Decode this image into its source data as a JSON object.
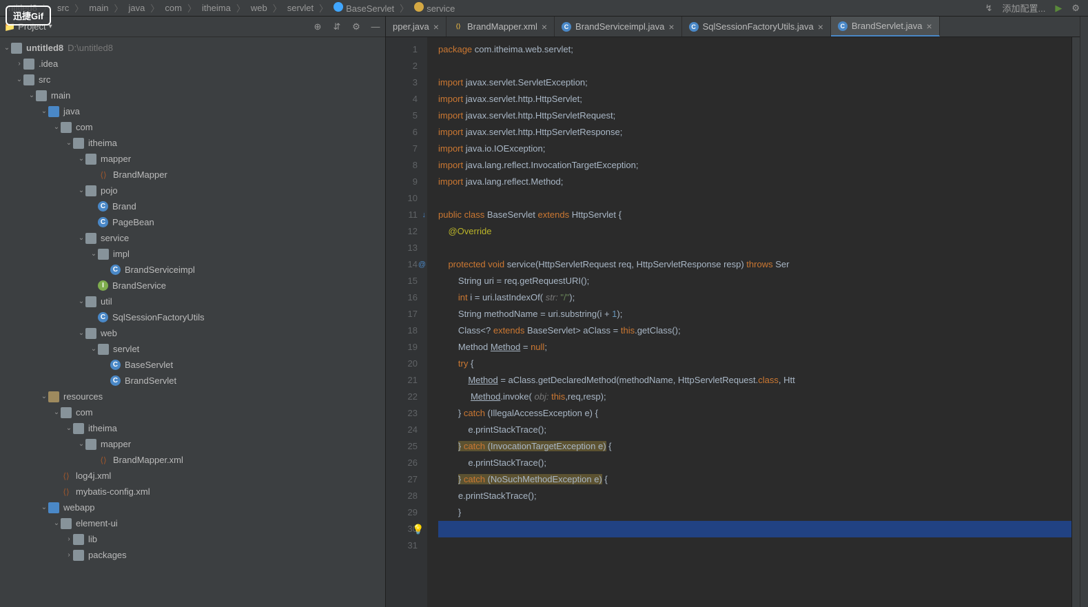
{
  "gifBadge": "迅捷Gif",
  "breadcrumb": {
    "items": [
      "ntitled8",
      "src",
      "main",
      "java",
      "com",
      "itheima",
      "web",
      "servlet",
      "BaseServlet",
      "service"
    ],
    "config": "添加配置..."
  },
  "sidebar": {
    "title": "Project",
    "root": {
      "label": "untitled8",
      "path": "D:\\untitled8"
    },
    "tree": [
      {
        "depth": 1,
        "chev": "›",
        "icon": "folder",
        "label": ".idea"
      },
      {
        "depth": 1,
        "chev": "⌄",
        "icon": "folder",
        "label": "src"
      },
      {
        "depth": 2,
        "chev": "⌄",
        "icon": "folder",
        "label": "main"
      },
      {
        "depth": 3,
        "chev": "⌄",
        "icon": "folder-blue",
        "label": "java"
      },
      {
        "depth": 4,
        "chev": "⌄",
        "icon": "folder",
        "label": "com"
      },
      {
        "depth": 5,
        "chev": "⌄",
        "icon": "folder",
        "label": "itheima"
      },
      {
        "depth": 6,
        "chev": "⌄",
        "icon": "folder",
        "label": "mapper"
      },
      {
        "depth": 7,
        "chev": "",
        "icon": "xml",
        "label": "BrandMapper"
      },
      {
        "depth": 6,
        "chev": "⌄",
        "icon": "folder",
        "label": "pojo"
      },
      {
        "depth": 7,
        "chev": "",
        "icon": "circle-c",
        "label": "Brand"
      },
      {
        "depth": 7,
        "chev": "",
        "icon": "circle-c",
        "label": "PageBean"
      },
      {
        "depth": 6,
        "chev": "⌄",
        "icon": "folder",
        "label": "service"
      },
      {
        "depth": 7,
        "chev": "⌄",
        "icon": "folder",
        "label": "impl"
      },
      {
        "depth": 8,
        "chev": "",
        "icon": "circle-c",
        "label": "BrandServiceimpl"
      },
      {
        "depth": 7,
        "chev": "",
        "icon": "circle-i",
        "label": "BrandService"
      },
      {
        "depth": 6,
        "chev": "⌄",
        "icon": "folder",
        "label": "util"
      },
      {
        "depth": 7,
        "chev": "",
        "icon": "circle-c",
        "label": "SqlSessionFactoryUtils"
      },
      {
        "depth": 6,
        "chev": "⌄",
        "icon": "folder",
        "label": "web"
      },
      {
        "depth": 7,
        "chev": "⌄",
        "icon": "folder",
        "label": "servlet"
      },
      {
        "depth": 8,
        "chev": "",
        "icon": "circle-c",
        "label": "BaseServlet"
      },
      {
        "depth": 8,
        "chev": "",
        "icon": "circle-c",
        "label": "BrandServlet"
      },
      {
        "depth": 3,
        "chev": "⌄",
        "icon": "folder-tan",
        "label": "resources"
      },
      {
        "depth": 4,
        "chev": "⌄",
        "icon": "folder",
        "label": "com"
      },
      {
        "depth": 5,
        "chev": "⌄",
        "icon": "folder",
        "label": "itheima"
      },
      {
        "depth": 6,
        "chev": "⌄",
        "icon": "folder",
        "label": "mapper"
      },
      {
        "depth": 7,
        "chev": "",
        "icon": "xml",
        "label": "BrandMapper.xml"
      },
      {
        "depth": 4,
        "chev": "",
        "icon": "xml",
        "label": "log4j.xml"
      },
      {
        "depth": 4,
        "chev": "",
        "icon": "xml",
        "label": "mybatis-config.xml"
      },
      {
        "depth": 3,
        "chev": "⌄",
        "icon": "folder-blue",
        "label": "webapp"
      },
      {
        "depth": 4,
        "chev": "⌄",
        "icon": "folder",
        "label": "element-ui"
      },
      {
        "depth": 5,
        "chev": "›",
        "icon": "folder",
        "label": "lib"
      },
      {
        "depth": 5,
        "chev": "›",
        "icon": "folder",
        "label": "packages"
      }
    ]
  },
  "tabs": [
    {
      "label": "pper.java",
      "icon": "",
      "active": false
    },
    {
      "label": "BrandMapper.xml",
      "icon": "xml",
      "active": false
    },
    {
      "label": "BrandServiceimpl.java",
      "icon": "blue",
      "active": false
    },
    {
      "label": "SqlSessionFactoryUtils.java",
      "icon": "blue",
      "active": false
    },
    {
      "label": "BrandServlet.java",
      "icon": "blue",
      "active": true
    }
  ],
  "code": {
    "lines": [
      {
        "n": 1,
        "html": "<span class='kw'>package</span> com.itheima.web.servlet;"
      },
      {
        "n": 2,
        "html": ""
      },
      {
        "n": 3,
        "html": "<span class='kw'>import</span> javax.servlet.ServletException;"
      },
      {
        "n": 4,
        "html": "<span class='kw'>import</span> javax.servlet.http.HttpServlet;"
      },
      {
        "n": 5,
        "html": "<span class='kw'>import</span> javax.servlet.http.HttpServletRequest;"
      },
      {
        "n": 6,
        "html": "<span class='kw'>import</span> javax.servlet.http.HttpServletResponse;"
      },
      {
        "n": 7,
        "html": "<span class='kw'>import</span> java.io.IOException;"
      },
      {
        "n": 8,
        "html": "<span class='kw'>import</span> java.lang.reflect.InvocationTargetException;"
      },
      {
        "n": 9,
        "html": "<span class='kw'>import</span> java.lang.reflect.Method;"
      },
      {
        "n": 10,
        "html": ""
      },
      {
        "n": 11,
        "html": "<span class='kw'>public class</span> BaseServlet <span class='kw'>extends</span> HttpServlet {",
        "mark": "↓"
      },
      {
        "n": 12,
        "html": "    <span class='ann'>@Override</span>"
      },
      {
        "n": 13,
        "html": ""
      },
      {
        "n": 14,
        "html": "    <span class='kw'>protected void</span> <span class='cls'>service</span>(HttpServletRequest req, HttpServletResponse resp) <span class='kw'>throws</span> <span class='cls'>Ser</span>",
        "mark": "@"
      },
      {
        "n": 15,
        "html": "        String uri = req.getRequestURI();"
      },
      {
        "n": 16,
        "html": "        <span class='kw'>int</span> i = uri.lastIndexOf( <span class='hint'>str:</span> <span class='str'>\"/\"</span>);"
      },
      {
        "n": 17,
        "html": "        String methodName = uri.substring(i + <span class='num'>1</span>);"
      },
      {
        "n": 18,
        "html": "        Class&lt;? <span class='kw'>extends</span> BaseServlet&gt; aClass = <span class='kw'>this</span>.getClass();"
      },
      {
        "n": 19,
        "html": "        Method <span class='ul'>Method</span> = <span class='kw'>null</span>;"
      },
      {
        "n": 20,
        "html": "        <span class='kw'>try</span> {"
      },
      {
        "n": 21,
        "html": "            <span class='ul'>Method</span> = aClass.getDeclaredMethod(methodName, HttpServletRequest.<span class='kw'>class</span>, Htt"
      },
      {
        "n": 22,
        "html": "             <span class='ul'>Method</span>.invoke( <span class='hint'>obj:</span> <span class='kw'>this</span>,req,resp);"
      },
      {
        "n": 23,
        "html": "        } <span class='kw'>catch</span> (IllegalAccessException e) {"
      },
      {
        "n": 24,
        "html": "            e.printStackTrace();"
      },
      {
        "n": 25,
        "html": "        <span class='hl'>} </span><span class='kw hl'>catch</span><span class='hl'> (InvocationTargetException e)</span> {"
      },
      {
        "n": 26,
        "html": "            e.printStackTrace();"
      },
      {
        "n": 27,
        "html": "        <span class='hl'>} </span><span class='kw hl'>catch</span><span class='hl'> (NoSuchMethodException e)</span> {"
      },
      {
        "n": 28,
        "html": "        e.printStackTrace();"
      },
      {
        "n": 29,
        "html": "        }"
      },
      {
        "n": 30,
        "html": "<span class='bulb'>💡</span>",
        "hl": "hl2"
      },
      {
        "n": 31,
        "html": ""
      }
    ]
  }
}
